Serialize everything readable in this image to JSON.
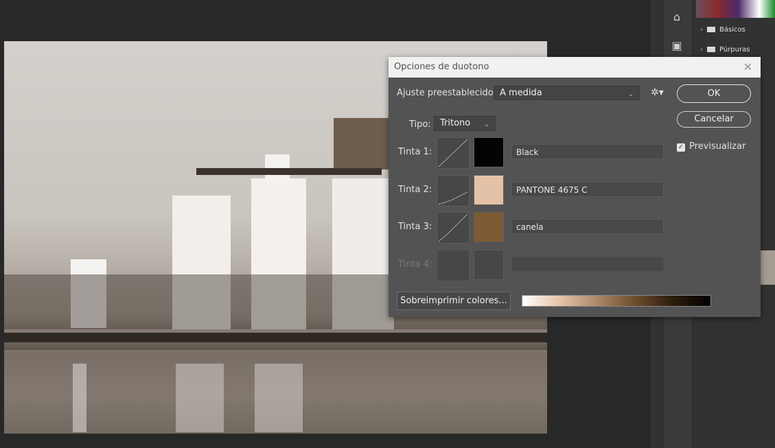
{
  "panel": {
    "folders": [
      {
        "label": "Básicos"
      },
      {
        "label": "Púrpuras"
      }
    ]
  },
  "dialog": {
    "title": "Opciones de duotono",
    "preset_label": "Ajuste preestablecido:",
    "preset_value": "A medida",
    "type_label": "Tipo:",
    "type_value": "Tritono",
    "ok_label": "OK",
    "cancel_label": "Cancelar",
    "preview_label": "Previsualizar",
    "preview_checked": true,
    "inks": [
      {
        "label": "Tinta 1:",
        "name": "Black",
        "color": "#030303",
        "enabled": true
      },
      {
        "label": "Tinta 2:",
        "name": "PANTONE 4675 C",
        "color": "#e4c2a7",
        "enabled": true
      },
      {
        "label": "Tinta 3:",
        "name": "canela",
        "color": "#7d5a33",
        "enabled": true
      },
      {
        "label": "Tinta 4:",
        "name": "",
        "color": "#474747",
        "enabled": false
      }
    ],
    "overprint_label": "Sobreimprimir colores..."
  }
}
